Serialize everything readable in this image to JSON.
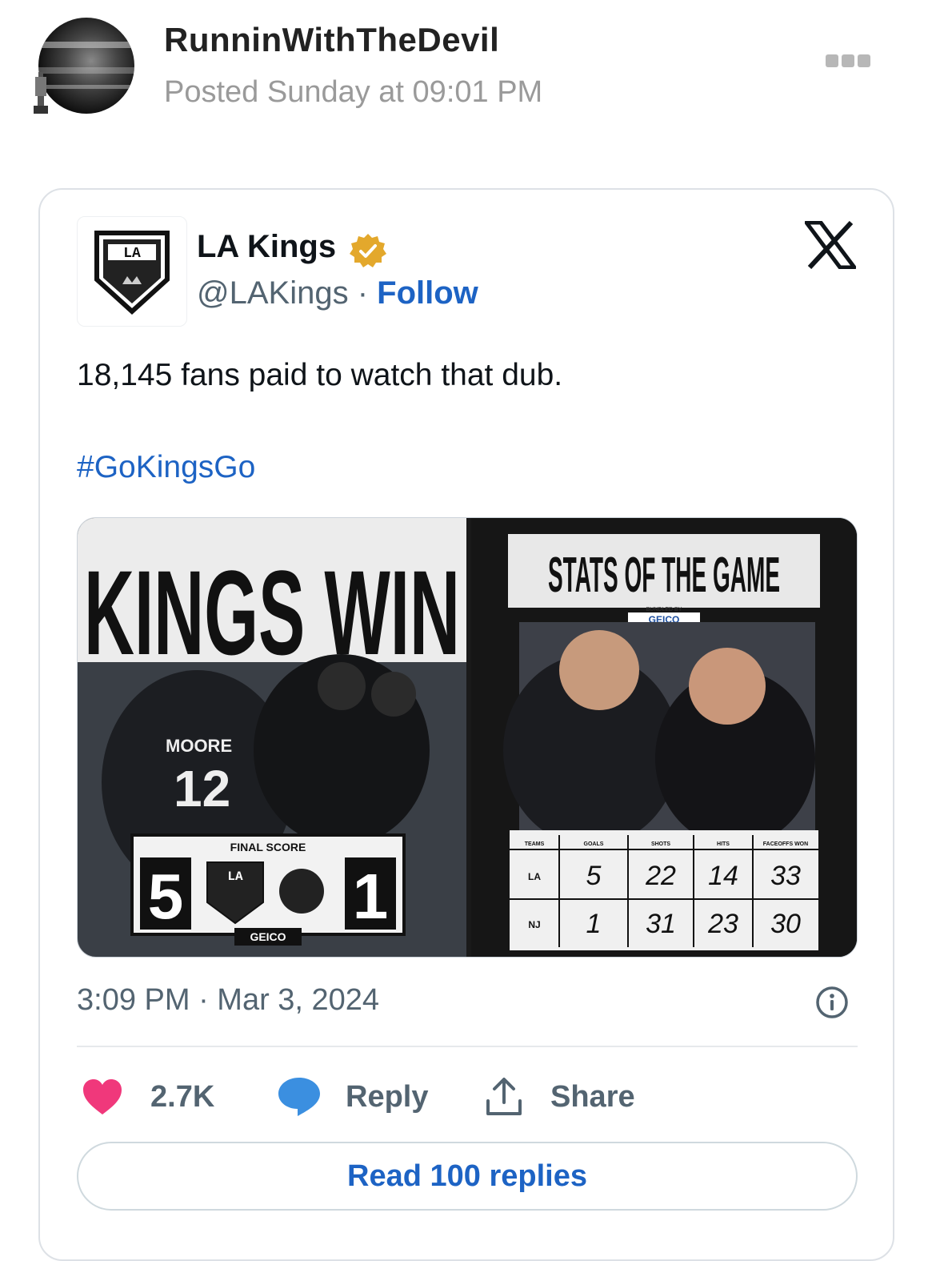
{
  "post": {
    "username": "RunninWithTheDevil",
    "posted": "Posted Sunday at 09:01 PM"
  },
  "embed": {
    "account_name": "LA Kings",
    "handle": "@LAKings",
    "separator": " · ",
    "follow_label": "Follow",
    "text": "18,145 fans paid to watch that dub.",
    "hashtag": "#GoKingsGo",
    "timestamp": "3:09 PM · Mar 3, 2024",
    "likes": "2.7K",
    "reply_label": "Reply",
    "share_label": "Share",
    "read_replies_label": "Read 100 replies"
  },
  "media_left": {
    "headline": "KINGS WIN",
    "player_name": "MOORE",
    "player_number": "12",
    "final_score_label": "FINAL SCORE",
    "home_score": "5",
    "away_score": "1",
    "sponsor": "GEICO",
    "team_logo_text": "LA"
  },
  "media_right": {
    "title": "STATS OF THE GAME",
    "bundled_by": "BUNDLED BY",
    "sponsor": "GEICO",
    "columns": [
      "TEAMS",
      "GOALS",
      "SHOTS",
      "HITS",
      "FACEOFFS WON"
    ],
    "rows": [
      {
        "team": "LA",
        "goals": "5",
        "shots": "22",
        "hits": "14",
        "faceoffs": "33"
      },
      {
        "team": "NJ",
        "goals": "1",
        "shots": "31",
        "hits": "23",
        "faceoffs": "30"
      }
    ]
  },
  "colors": {
    "link_blue": "#1d63c4",
    "heart_pink": "#f0387b",
    "reply_blue": "#3b8fe0",
    "text_gray": "#536471"
  },
  "icons": [
    "more-icon",
    "kings-logo-icon",
    "verified-badge-icon",
    "x-logo-icon",
    "info-icon",
    "heart-icon",
    "reply-bubble-icon",
    "share-icon"
  ]
}
